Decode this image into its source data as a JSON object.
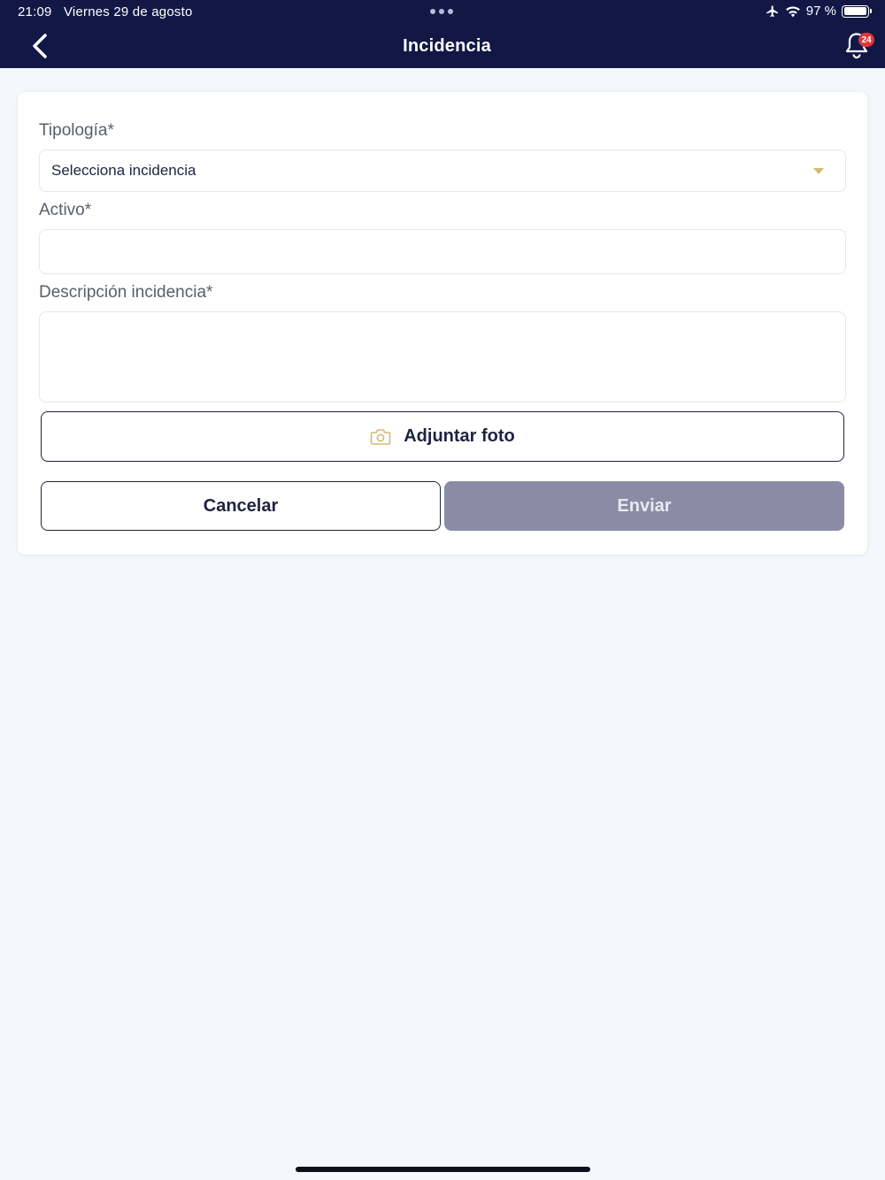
{
  "status_bar": {
    "time": "21:09",
    "date": "Viernes 29 de agosto",
    "battery": "97 %",
    "battery_level": 0.97
  },
  "header": {
    "title": "Incidencia",
    "notification_count": "24",
    "background": "#121846"
  },
  "form": {
    "tipologia_label": "Tipología*",
    "tipologia_value": "Selecciona incidencia",
    "activo_label": "Activo*",
    "activo_value": "",
    "descripcion_label": "Descripción incidencia*",
    "descripcion_value": ""
  },
  "actions": {
    "attach_label": "Adjuntar foto",
    "cancel_label": "Cancelar",
    "send_label": "Enviar"
  },
  "colors": {
    "accent": "#d6b874",
    "primary_text": "#1f2340",
    "disabled_button": "#8a8ca6",
    "badge": "#e0363b"
  },
  "icons": [
    "back-arrow-icon",
    "bell-icon",
    "camera-icon",
    "airplane-icon",
    "wifi-icon",
    "battery-icon",
    "chevron-down-icon"
  ]
}
